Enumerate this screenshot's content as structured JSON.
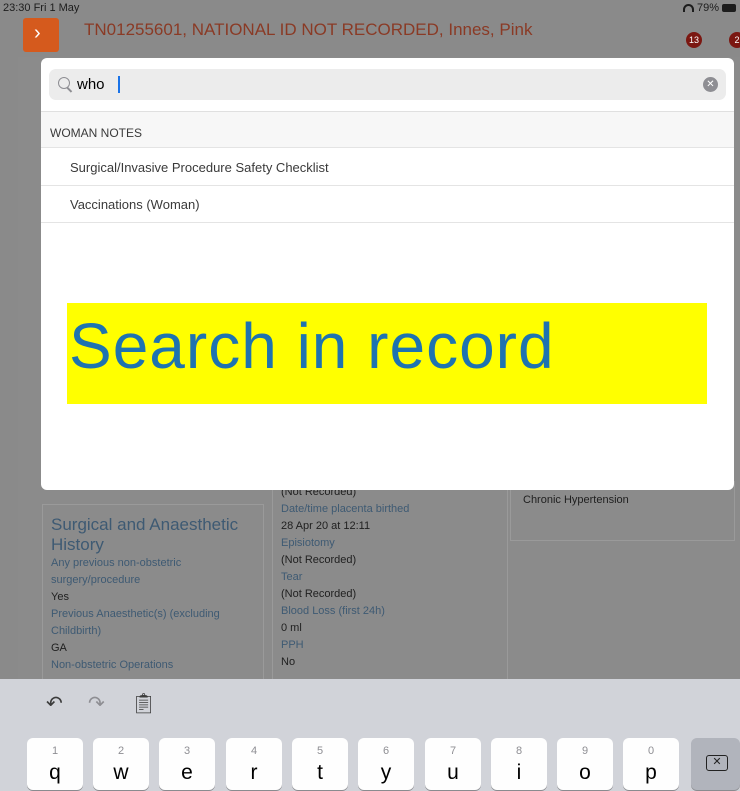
{
  "status_bar": {
    "time": "23:30  Fri 1 May",
    "battery": "79%"
  },
  "header": {
    "patient_title": "TN01255601, NATIONAL ID NOT RECORDED, Innes, Pink",
    "badge_tasks": "13",
    "badge_alerts": "2"
  },
  "search": {
    "query": "who"
  },
  "results": {
    "section_title": "WOMAN NOTES",
    "items": [
      {
        "label": "Surgical/Invasive Procedure Safety Checklist"
      },
      {
        "label": "Vaccinations (Woman)"
      }
    ]
  },
  "banner": {
    "text": "Search in record",
    "bg_color": "#ffff00",
    "text_color": "#1e73b0"
  },
  "background": {
    "left_card": {
      "title": "Surgical and Anaesthetic History",
      "label_1": "Any previous non-obstetric surgery/procedure",
      "value_1": "Yes",
      "label_2": "Previous Anaesthetic(s) (excluding Childbirth)",
      "value_2": "GA",
      "label_3": "Non-obstetric Operations"
    },
    "middle_card": {
      "value_0": "(Not Recorded)",
      "label_1": "Date/time placenta birthed",
      "value_1": "28 Apr 20 at 12:11",
      "label_2": "Episiotomy",
      "value_2": "(Not Recorded)",
      "label_3": "Tear",
      "value_3": "(Not Recorded)",
      "label_4": "Blood Loss (first 24h)",
      "value_4": "0 ml",
      "label_5": "PPH",
      "value_5": "No"
    },
    "right_card": {
      "value_1": "Chronic Hypertension"
    }
  },
  "keyboard": {
    "keys": [
      {
        "num": "1",
        "ch": "q"
      },
      {
        "num": "2",
        "ch": "w"
      },
      {
        "num": "3",
        "ch": "e"
      },
      {
        "num": "4",
        "ch": "r"
      },
      {
        "num": "5",
        "ch": "t"
      },
      {
        "num": "6",
        "ch": "y"
      },
      {
        "num": "7",
        "ch": "u"
      },
      {
        "num": "8",
        "ch": "i"
      },
      {
        "num": "9",
        "ch": "o"
      },
      {
        "num": "0",
        "ch": "p"
      }
    ]
  }
}
